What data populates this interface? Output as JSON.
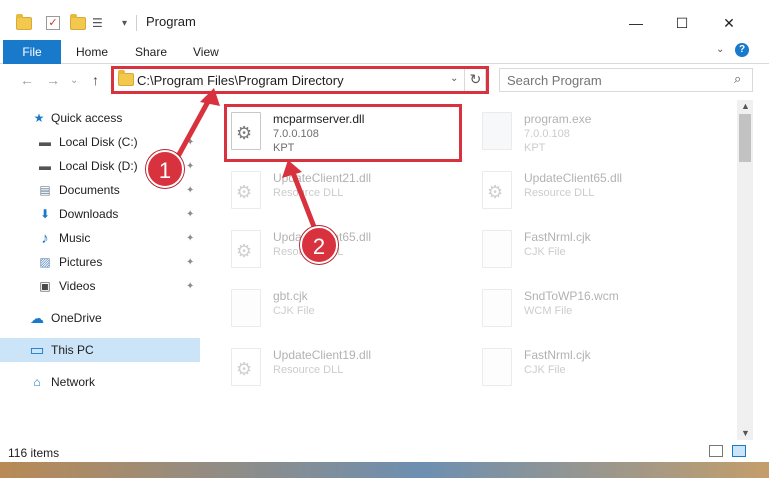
{
  "window": {
    "title": "Program",
    "min_glyph": "—",
    "max_glyph": "☐",
    "close_glyph": "✕"
  },
  "ribbon": {
    "tabs": [
      "File",
      "Home",
      "Share",
      "View"
    ],
    "help_glyph": "?",
    "collapse_glyph": "⌄"
  },
  "address": {
    "path": "C:\\Program Files\\Program Directory",
    "drop_glyph": "⌄",
    "refresh_glyph": "↻",
    "back_glyph": "←",
    "forward_glyph": "→",
    "recent_glyph": "⌄",
    "up_glyph": "↑"
  },
  "search": {
    "placeholder": "Search Program",
    "icon_glyph": "⌕"
  },
  "sidebar": {
    "items": [
      {
        "label": "Quick access",
        "icon": "star-icon",
        "glyph": "★",
        "color": "#1979ca",
        "pinned": false
      },
      {
        "label": "Local Disk (C:)",
        "icon": "drive-icon",
        "glyph": "▬",
        "color": "#555555",
        "pinned": true
      },
      {
        "label": "Local Disk (D:)",
        "icon": "drive-icon",
        "glyph": "▬",
        "color": "#555555",
        "pinned": true
      },
      {
        "label": "Documents",
        "icon": "documents-icon",
        "glyph": "▤",
        "color": "#6a7f96",
        "pinned": true
      },
      {
        "label": "Downloads",
        "icon": "download-icon",
        "glyph": "⬇",
        "color": "#1979ca",
        "pinned": true
      },
      {
        "label": "Music",
        "icon": "music-icon",
        "glyph": "♪",
        "color": "#1979ca",
        "pinned": true
      },
      {
        "label": "Pictures",
        "icon": "pictures-icon",
        "glyph": "▨",
        "color": "#5a86b8",
        "pinned": true
      },
      {
        "label": "Videos",
        "icon": "videos-icon",
        "glyph": "▣",
        "color": "#4a4a4a",
        "pinned": true
      },
      {
        "label": "OneDrive",
        "icon": "cloud-icon",
        "glyph": "☁",
        "color": "#1979ca",
        "pinned": false
      },
      {
        "label": "This PC",
        "icon": "computer-icon",
        "glyph": "▭",
        "color": "#1979ca",
        "pinned": false,
        "selected": true
      },
      {
        "label": "Network",
        "icon": "network-icon",
        "glyph": "⌂",
        "color": "#1979ca",
        "pinned": false
      }
    ],
    "pin_glyph": "✦"
  },
  "files": [
    {
      "name": "mcparmserver.dll",
      "line2": "7.0.0.108",
      "line3": "KPT",
      "icon": "gear-icon",
      "highlighted": true
    },
    {
      "name": "program.exe",
      "line2": "7.0.0.108",
      "line3": "KPT",
      "icon": "exe-icon",
      "faded": true
    },
    {
      "name": "UpdateClient21.dll",
      "line2": "Resource DLL",
      "line3": "",
      "icon": "gear-icon",
      "faded": true
    },
    {
      "name": "UpdateClient65.dll",
      "line2": "Resource DLL",
      "line3": "",
      "icon": "gear-icon",
      "faded": true
    },
    {
      "name": "UpdateClient65.dll",
      "line2": "Resource DLL",
      "line3": "",
      "icon": "gear-icon",
      "faded": true
    },
    {
      "name": "FastNrml.cjk",
      "line2": "CJK File",
      "line3": "",
      "icon": "document-icon",
      "faded": true
    },
    {
      "name": "gbt.cjk",
      "line2": "CJK File",
      "line3": "",
      "icon": "document-icon",
      "faded": true
    },
    {
      "name": "SndToWP16.wcm",
      "line2": "WCM File",
      "line3": "",
      "icon": "document-icon",
      "faded": true
    },
    {
      "name": "UpdateClient19.dll",
      "line2": "Resource DLL",
      "line3": "",
      "icon": "gear-icon",
      "faded": true
    },
    {
      "name": "FastNrml.cjk",
      "line2": "CJK File",
      "line3": "",
      "icon": "document-icon",
      "faded": true
    }
  ],
  "status": {
    "item_count": "116 items"
  },
  "callouts": [
    "1",
    "2"
  ],
  "colors": {
    "accent": "#1979ca",
    "annotation": "#d8323e",
    "selected_bg": "#cce4f7"
  }
}
